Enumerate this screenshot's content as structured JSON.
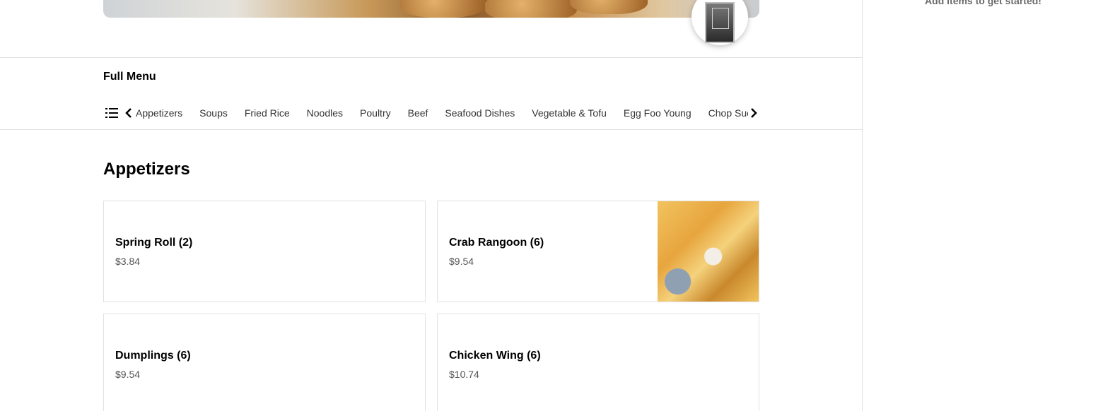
{
  "cart": {
    "empty_text": "Add items to get started!"
  },
  "menu": {
    "title": "Full Menu",
    "categories": [
      "Appetizers",
      "Soups",
      "Fried Rice",
      "Noodles",
      "Poultry",
      "Beef",
      "Seafood Dishes",
      "Vegetable & Tofu",
      "Egg Foo Young",
      "Chop Suey"
    ]
  },
  "section": {
    "title": "Appetizers",
    "items": [
      {
        "name": "Spring Roll (2)",
        "price": "$3.84"
      },
      {
        "name": "Crab Rangoon (6)",
        "price": "$9.54"
      },
      {
        "name": "Dumplings (6)",
        "price": "$9.54"
      },
      {
        "name": "Chicken Wing (6)",
        "price": "$10.74"
      }
    ]
  }
}
